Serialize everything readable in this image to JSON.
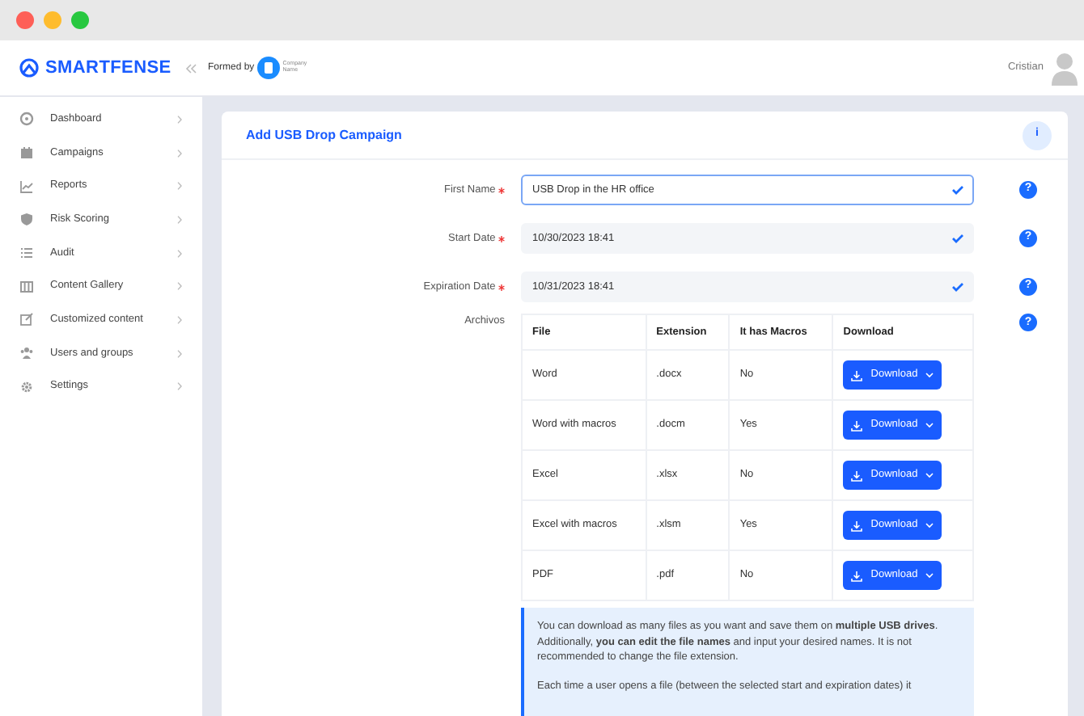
{
  "brand": {
    "name": "SMARTFENSE"
  },
  "header": {
    "formed_by": "Formed by",
    "company_logo": [
      "Company",
      "Name"
    ],
    "user": "Cristian"
  },
  "sidebar": {
    "items": [
      {
        "label": "Dashboard"
      },
      {
        "label": "Campaigns"
      },
      {
        "label": "Reports"
      },
      {
        "label": "Risk Scoring"
      },
      {
        "label": "Audit"
      },
      {
        "label": "Content Gallery"
      },
      {
        "label": "Customized content"
      },
      {
        "label": "Users and groups"
      },
      {
        "label": "Settings"
      }
    ]
  },
  "card": {
    "title": "Add USB Drop Campaign",
    "info_button": "i",
    "help_button": "?",
    "fields": [
      {
        "label": "First Name",
        "required": true,
        "value": "USB Drop in the HR office",
        "focused": true,
        "valid": true
      },
      {
        "label": "Start Date",
        "required": true,
        "value": "10/30/2023 18:41",
        "focused": false,
        "valid": true
      },
      {
        "label": "Expiration Date",
        "required": true,
        "value": "10/31/2023 18:41",
        "focused": false,
        "valid": true
      }
    ],
    "files": {
      "label": "Archivos",
      "columns": [
        "File",
        "Extension",
        "It has Macros",
        "Download"
      ],
      "rows": [
        {
          "file": "Word",
          "extension": ".docx",
          "macros": "No",
          "button": "Download"
        },
        {
          "file": "Word with macros",
          "extension": ".docm",
          "macros": "Yes",
          "button": "Download"
        },
        {
          "file": "Excel",
          "extension": ".xlsx",
          "macros": "No",
          "button": "Download"
        },
        {
          "file": "Excel with macros",
          "extension": ".xlsm",
          "macros": "Yes",
          "button": "Download"
        },
        {
          "file": "PDF",
          "extension": ".pdf",
          "macros": "No",
          "button": "Download"
        }
      ]
    },
    "info": [
      "You can download as many files as you want and save them on **multiple USB drives**. Additionally, **you can edit the file names** and input your desired names. It is not recommended to change the file extension.",
      "Each time a user opens a file (between the selected start and expiration dates) it"
    ]
  }
}
